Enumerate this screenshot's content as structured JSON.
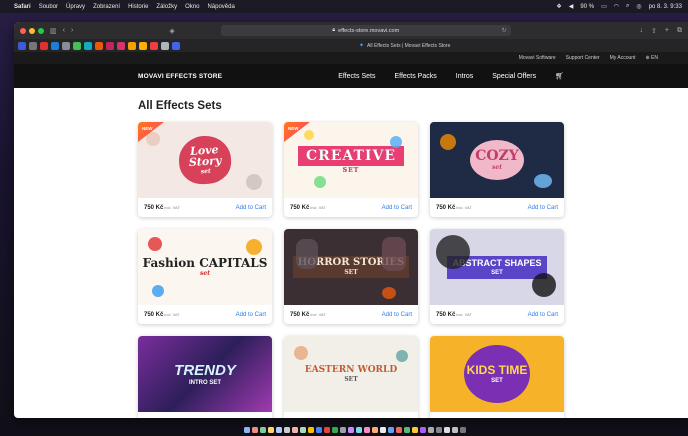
{
  "menubar": {
    "app": "Safari",
    "items": [
      "Soubor",
      "Úpravy",
      "Zobrazení",
      "Historie",
      "Záložky",
      "Okno",
      "Nápověda"
    ],
    "battery": "90 %",
    "clock": "po 8. 3.  9:33"
  },
  "browser": {
    "url": "effects-store.movavi.com",
    "tab_title": "All Effects Sets | Movavi Effects Store"
  },
  "site": {
    "topbar": [
      "Movavi Software",
      "Support Center",
      "My Account",
      "EN"
    ],
    "logo": "MOVAVI EFFECTS STORE",
    "nav": [
      "Effects Sets",
      "Effects Packs",
      "Intros",
      "Special Offers"
    ],
    "page_title": "All Effects Sets",
    "new_badge": "NEW",
    "vat_label": "incl. VAT",
    "add_label": "Add to Cart",
    "cards": [
      {
        "title": "Love Story",
        "sub": "set",
        "price": "750 Kč",
        "new": true
      },
      {
        "title": "CREATIVE",
        "sub": "SET",
        "price": "750 Kč",
        "new": true
      },
      {
        "title": "COZY",
        "sub": "set",
        "price": "750 Kč",
        "new": false
      },
      {
        "title": "Fashion CAPITALS",
        "sub": "set",
        "price": "750 Kč",
        "new": false
      },
      {
        "title": "HORROR STORIES",
        "sub": "SET",
        "price": "750 Kč",
        "new": false
      },
      {
        "title": "ABSTRACT SHAPES",
        "sub": "SET",
        "price": "750 Kč",
        "new": false
      },
      {
        "title": "TRENDY",
        "sub": "INTRO SET",
        "price": "",
        "new": false
      },
      {
        "title": "EASTERN WORLD",
        "sub": "SET",
        "price": "",
        "new": false
      },
      {
        "title": "KIDS TIME",
        "sub": "SET",
        "price": "",
        "new": false
      }
    ]
  },
  "colors": {
    "accent_link": "#2b7de9",
    "nav_bg": "#111111",
    "new_badge": "#ff5a3c"
  }
}
